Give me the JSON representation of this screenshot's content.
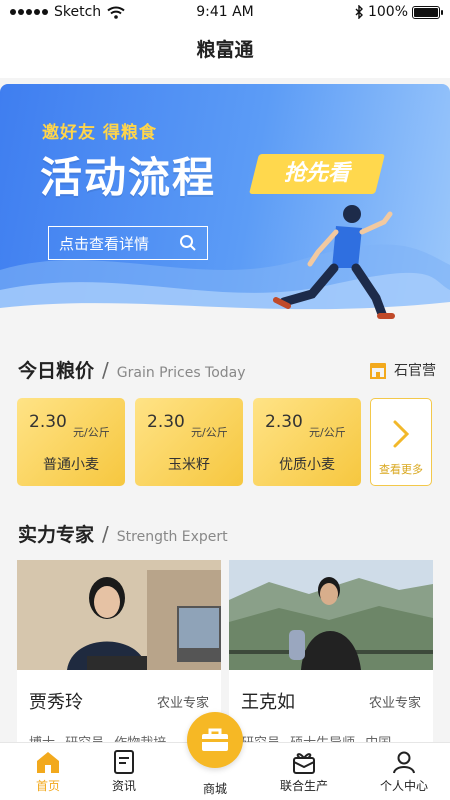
{
  "status_bar": {
    "carrier": "Sketch",
    "time": "9:41 AM",
    "battery": "100%"
  },
  "nav": {
    "title": "粮富通"
  },
  "banner": {
    "subtitle": "邀好友  得粮食",
    "title": "活动流程",
    "tag": "抢先看",
    "detail_button": "点击查看详情"
  },
  "prices_section": {
    "title_zh": "今日粮价",
    "title_en": "Grain Prices Today",
    "location": "石官营",
    "items": [
      {
        "price": "2.30",
        "unit": "元/公斤",
        "name": "普通小麦"
      },
      {
        "price": "2.30",
        "unit": "元/公斤",
        "name": "玉米籽"
      },
      {
        "price": "2.30",
        "unit": "元/公斤",
        "name": "优质小麦"
      }
    ],
    "more_label": "查看更多"
  },
  "experts_section": {
    "title_zh": "实力专家",
    "title_en": "Strength Expert",
    "items": [
      {
        "name": "贾秀玲",
        "role": "农业专家",
        "tags": "博士  研究员  作物栽培"
      },
      {
        "name": "王克如",
        "role": "农业专家",
        "tags": "研究员  硕士生导师  中国"
      }
    ]
  },
  "tabbar": {
    "items": [
      {
        "label": "首页",
        "active": true
      },
      {
        "label": "资讯"
      },
      {
        "label": "商城"
      },
      {
        "label": "联合生产"
      },
      {
        "label": "个人中心"
      }
    ]
  },
  "colors": {
    "accent": "#f2a91d",
    "banner_blue": "#3f7ef0",
    "card_yellow": "#f6c73f"
  }
}
